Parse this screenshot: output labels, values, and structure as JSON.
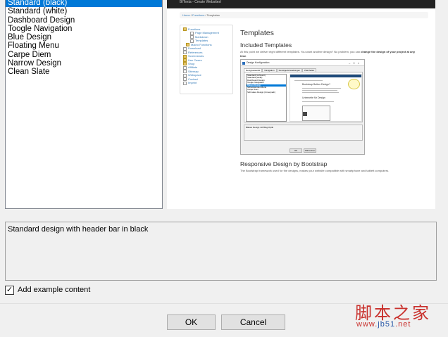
{
  "templates": {
    "items": [
      "Standard (black)",
      "Standard (white)",
      "Dashboard Design",
      "Toogle Navigation",
      "Blue Design",
      "Floating Menu",
      "Carpe Diem",
      "Narrow Design",
      "Clean Slate"
    ],
    "selected_index": 0
  },
  "preview": {
    "brand": "BITexta - Create Websites!",
    "breadcrumb": [
      "Home",
      "Functions",
      "Templates"
    ],
    "sidebar": [
      {
        "label": "Functions",
        "level": 0,
        "kind": "folder"
      },
      {
        "label": "Page Management",
        "level": 2,
        "kind": "page"
      },
      {
        "label": "Markdown",
        "level": 2,
        "kind": "page"
      },
      {
        "label": "Templates",
        "level": 2,
        "kind": "page"
      },
      {
        "label": "Macro Functions",
        "level": 1,
        "kind": "folder"
      },
      {
        "label": "Download",
        "level": 0,
        "kind": "page"
      },
      {
        "label": "References",
        "level": 0,
        "kind": "page"
      },
      {
        "label": "Screenshots",
        "level": 0,
        "kind": "folder"
      },
      {
        "label": "Use Cases",
        "level": 0,
        "kind": "folder"
      },
      {
        "label": "Shop",
        "level": 0,
        "kind": "folder"
      },
      {
        "label": "Affiliate",
        "level": 0,
        "kind": "page"
      },
      {
        "label": "Sitemap",
        "level": 0,
        "kind": "page"
      },
      {
        "label": "Webspace",
        "level": 0,
        "kind": "page"
      },
      {
        "label": "Contact",
        "level": 0,
        "kind": "page"
      },
      {
        "label": "Imprint",
        "level": 0,
        "kind": "page"
      }
    ],
    "heading": "Templates",
    "subheading": "Included Templates",
    "paragraph_start": "At this point we deliver eight different templates. You want another design? No problem, you can ",
    "paragraph_bold": "change the design of your project at any time",
    "paragraph_end": ".",
    "mini_dialog": {
      "title": "Design Konfiguration",
      "tabs": [
        "Designauswahl",
        "Navigation",
        "Sonstige Einstellungen",
        "Platzhalter"
      ],
      "list": [
        "Standard (schwarz)",
        "Standard (weiß)",
        "Dashboard Design",
        "Toogle Navigation",
        "Blaues Design",
        "Schwebendes Menü",
        "Carpe Diem",
        "Schmales Design (Unserpadi)"
      ],
      "selected_index": 4,
      "preview_title": "Bootstrap Button Design?",
      "preview_section": "Unterseite für Design",
      "description": "Blaues Design mit Blog-Optik",
      "ok_label": "OK",
      "cancel_label": "Abbrechen"
    },
    "section_heading": "Responsive Design by Bootstrap",
    "section_text": "The Bootstrap framework used for the designs, makes your website compatible with smartphone and tablett computers."
  },
  "description": "Standard design with header bar in black",
  "example_content": {
    "label": "Add example content",
    "checked": true
  },
  "buttons": {
    "ok": "OK",
    "cancel": "Cancel"
  },
  "watermark": {
    "chinese": "脚本之家",
    "url_prefix": "www.",
    "url_highlight": "jb51",
    "url_suffix": ".net"
  }
}
